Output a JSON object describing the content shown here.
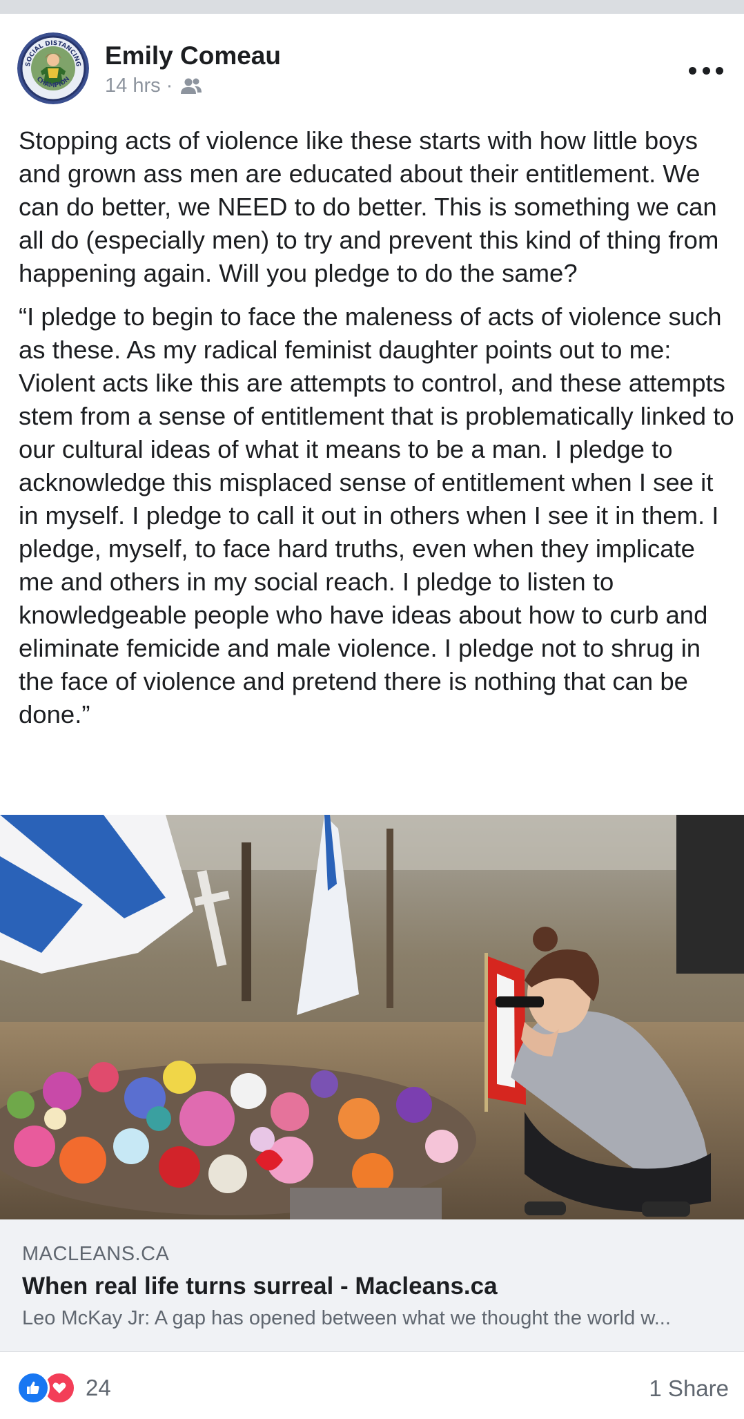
{
  "post": {
    "author": "Emily Comeau",
    "time": "14 hrs",
    "separator": "·",
    "audience_icon": "friends-icon",
    "avatar_badge_top": "SOCIAL DISTANCING",
    "avatar_badge_bottom": "CHAMPION",
    "paragraphs": [
      "Stopping acts of violence like these starts with how little boys and grown ass men are educated about their entitlement. We can do better, we NEED to do better. This is something we can all do (especially men) to try and prevent this kind of thing from happening again. Will you pledge to do the same?",
      "“I pledge to begin to face the maleness of acts of violence such as these. As my radical feminist daughter points out to me: Violent acts like this are attempts to control, and these attempts stem from a sense of entitlement that is problematically linked to our cultural ideas of what it means to be a man. I pledge to acknowledge this misplaced sense of entitlement when I see it in myself. I pledge to call it out in others when I see it in them. I pledge, myself, to face hard truths, even when they implicate me and others in my social reach. I pledge to listen to knowledgeable people who have ideas about how to curb and eliminate femicide and male violence. I pledge not to shrug in the face of violence and pretend there is nothing that can be done.”"
    ]
  },
  "link": {
    "domain": "MACLEANS.CA",
    "title": "When real life turns surreal - Macleans.ca",
    "description": "Leo McKay Jr: A gap has opened between what we thought the world w..."
  },
  "footer": {
    "reaction_count": "24",
    "shares": "1 Share"
  },
  "colors": {
    "like": "#1877f2",
    "love": "#f33e58",
    "secondary_text": "#606770"
  }
}
